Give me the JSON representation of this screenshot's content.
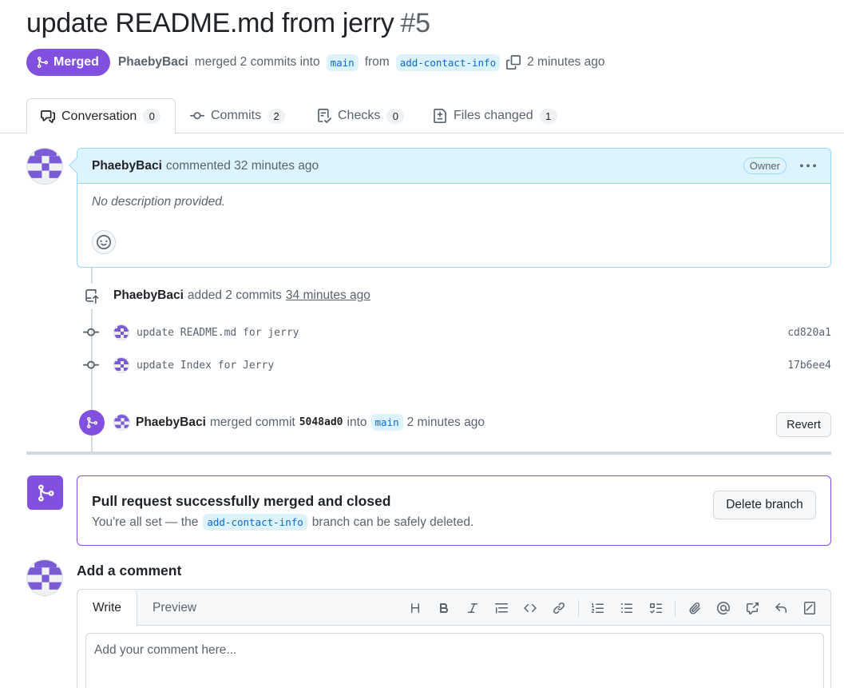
{
  "header": {
    "title": "update README.md from jerry",
    "number": "#5",
    "state": "Merged",
    "author": "PhaebyBaci",
    "merged_text": "merged 2 commits into",
    "base_branch": "main",
    "from_text": "from",
    "head_branch": "add-contact-info",
    "time": "2 minutes ago"
  },
  "tabs": [
    {
      "label": "Conversation",
      "count": "0"
    },
    {
      "label": "Commits",
      "count": "2"
    },
    {
      "label": "Checks",
      "count": "0"
    },
    {
      "label": "Files changed",
      "count": "1"
    }
  ],
  "comment": {
    "author": "PhaebyBaci",
    "action": "commented 32 minutes ago",
    "badge": "Owner",
    "body": "No description provided."
  },
  "timeline": {
    "commits_event": {
      "author": "PhaebyBaci",
      "action": "added 2 commits",
      "time": "34 minutes ago"
    },
    "commits": [
      {
        "message": "update README.md for jerry",
        "sha": "cd820a1"
      },
      {
        "message": "update Index for Jerry",
        "sha": "17b6ee4"
      }
    ],
    "merge_event": {
      "author": "PhaebyBaci",
      "action": "merged commit",
      "sha": "5048ad0",
      "into": "into",
      "branch": "main",
      "time": "2 minutes ago",
      "revert_label": "Revert"
    }
  },
  "merged_box": {
    "title": "Pull request successfully merged and closed",
    "sub_prefix": "You're all set — the",
    "branch": "add-contact-info",
    "sub_suffix": "branch can be safely deleted.",
    "delete_label": "Delete branch"
  },
  "add_comment": {
    "title": "Add a comment",
    "write_tab": "Write",
    "preview_tab": "Preview",
    "placeholder": "Add your comment here..."
  },
  "colors": {
    "merged_purple": "#8250df",
    "accent_blue": "#0969da",
    "comment_header_bg": "#ddf4ff"
  }
}
